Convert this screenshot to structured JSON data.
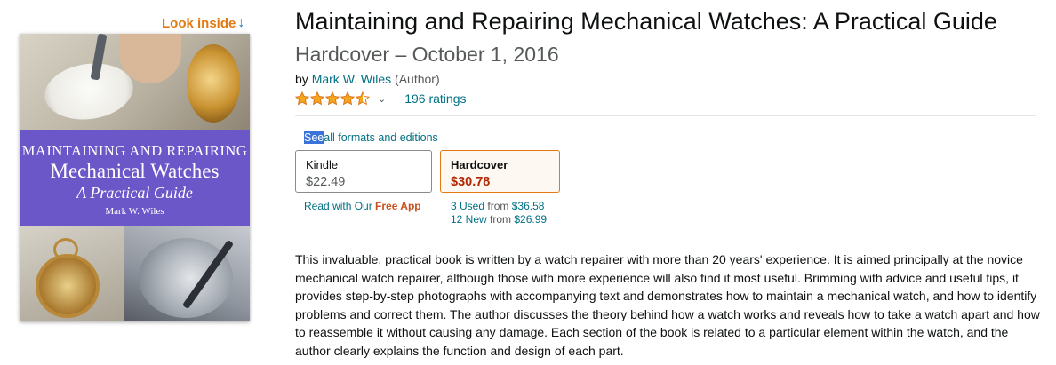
{
  "look_inside": {
    "label": "Look inside",
    "arrow": "↓"
  },
  "cover": {
    "line1": "MAINTAINING AND REPAIRING",
    "line2": "Mechanical Watches",
    "line3": "A Practical Guide",
    "author": "Mark W. Wiles",
    "band_color": "#6b57c7"
  },
  "product": {
    "title": "Maintaining and Repairing Mechanical Watches: A Practical Guide",
    "format_date": "Hardcover – October 1, 2016",
    "by": "by",
    "author": "Mark W. Wiles",
    "author_role": "(Author)",
    "rating_stars": 4.5,
    "ratings_count": "196 ratings"
  },
  "formats": {
    "see_all_selected": "See",
    "see_all_rest": "all formats and editions",
    "kindle": {
      "label": "Kindle",
      "price": "$22.49",
      "note_prefix": "Read with Our ",
      "note_bold": "Free App"
    },
    "hardcover": {
      "label": "Hardcover",
      "price": "$30.78",
      "used_link": "3 Used",
      "used_from": "from",
      "used_price": "$36.58",
      "new_link": "12 New",
      "new_from": "from",
      "new_price": "$26.99"
    }
  },
  "description": "This invaluable, practical book is written by a watch repairer with more than 20 years' experience. It is aimed principally at the novice mechanical watch repairer, although those with more experience will also find it most useful. Brimming with advice and useful tips, it provides step-by-step photographs with accompanying text and demonstrates how to maintain a mechanical watch, and how to identify problems and correct them. The author discusses the theory behind how a watch works and reveals how to take a watch apart and how to reassemble it without causing any damage. Each section of the book is related to a particular element within the watch, and the author clearly explains the function and design of each part.",
  "colors": {
    "link": "#007185",
    "accent_orange": "#e47911",
    "price_red": "#b12704",
    "star": "#f4a71d"
  }
}
